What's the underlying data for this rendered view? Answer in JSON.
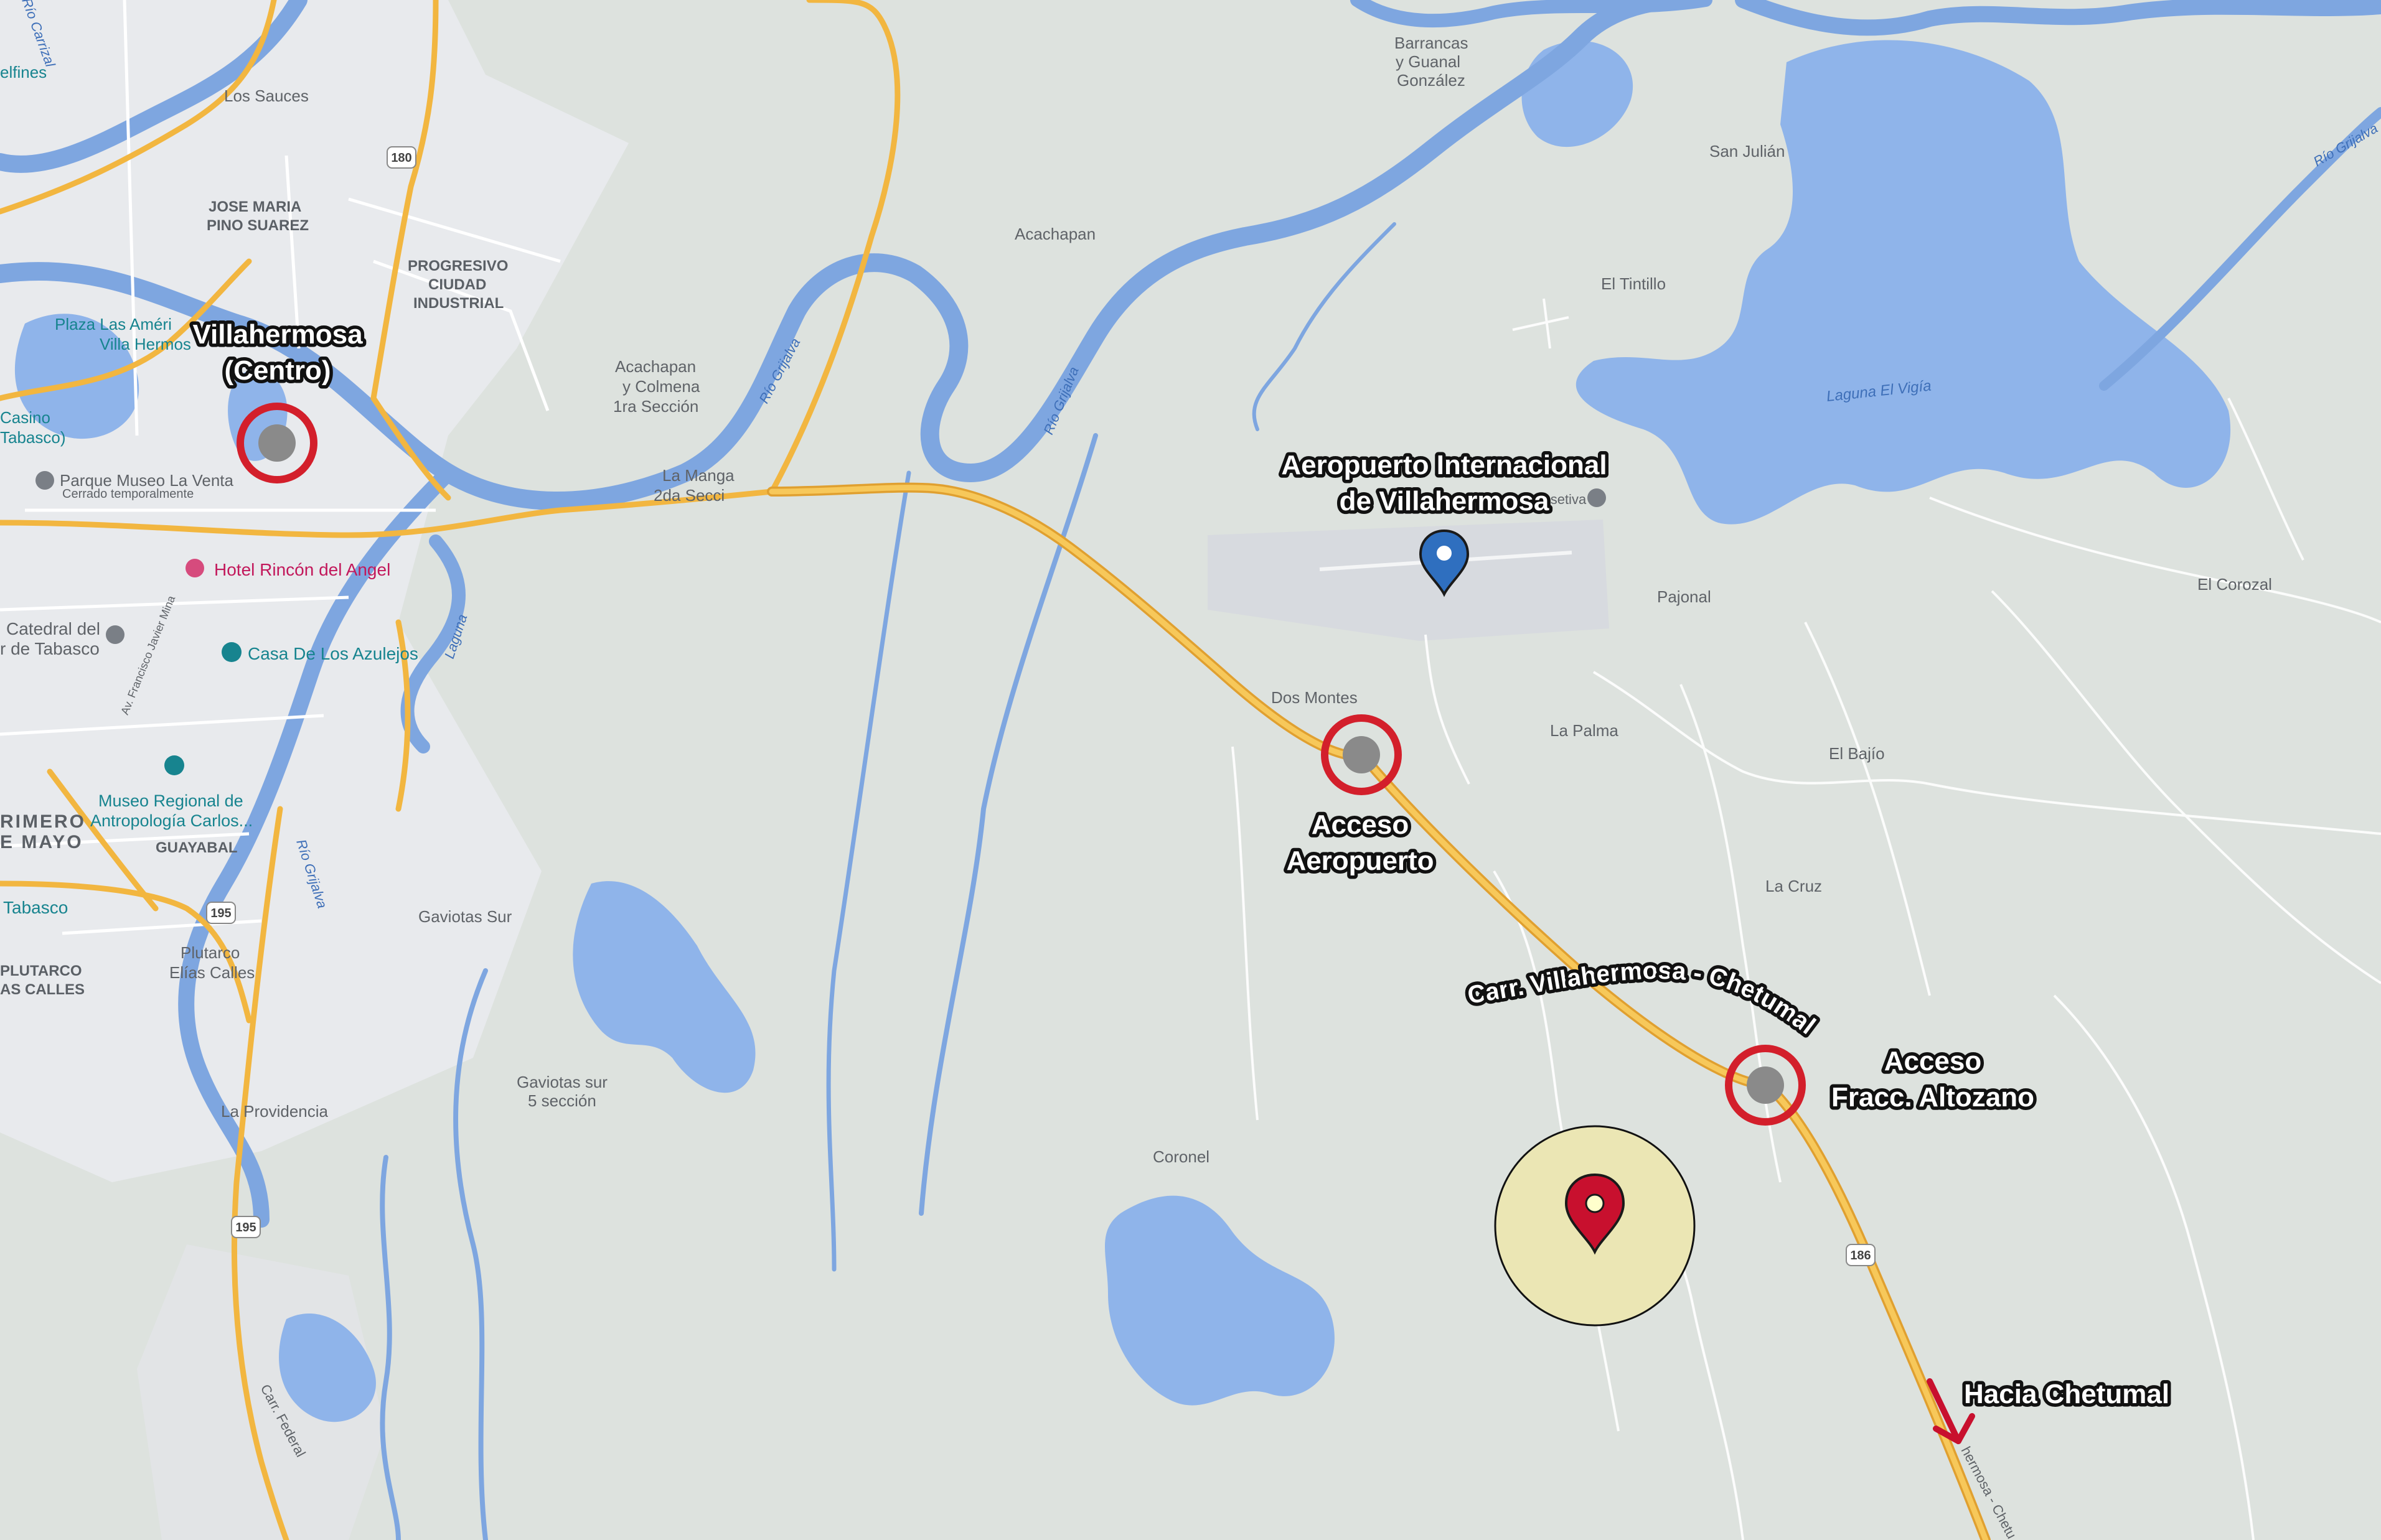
{
  "map": {
    "colors": {
      "land": "#dde2de",
      "urban": "#e8eaed",
      "water": "#8fb4ea",
      "river": "#7ea6e0",
      "highway": "#f2b640",
      "highway_casing": "#e0a030",
      "minor_road": "#ffffff",
      "airport": "#d7dadf",
      "marker_red": "#c8102e",
      "marker_blue": "#2f6fbf",
      "highlight_circle": "#ebe6b4"
    },
    "place_labels": {
      "los_sauces": "Los Sauces",
      "jose_maria_1": "JOSE MARIA",
      "jose_maria_2": "PINO SUAREZ",
      "progresivo_1": "PROGRESIVO",
      "progresivo_2": "CIUDAD",
      "progresivo_3": "INDUSTRIAL",
      "plaza_1": "Plaza Las Améri",
      "plaza_2": "Villa Hermos",
      "casino_1": "Casino",
      "casino_2": "Tabasco)",
      "parque_museo": "Parque Museo La Venta",
      "cerrado": "Cerrado temporalmente",
      "hotel": "Hotel Rincón del Angel",
      "catedral_1": "Catedral del",
      "catedral_2": "r de Tabasco",
      "casa_azulejos": "Casa De Los Azulejos",
      "museo_1": "Museo Regional de",
      "museo_2": "Antropología Carlos...",
      "primero_1": "RIMERO",
      "primero_2": "E MAYO",
      "guayabal": "GUAYABAL",
      "tabasco": "Tabasco",
      "plutarco_1": "PLUTARCO",
      "plutarco_2": "AS CALLES",
      "plutarco_elias_1": "Plutarco",
      "plutarco_elias_2": "Elías Calles",
      "gaviotas_sur": "Gaviotas Sur",
      "gaviotas_5_1": "Gaviotas sur",
      "gaviotas_5_2": "5 sección",
      "la_providencia": "La Providencia",
      "acachapan": "Acachapan",
      "acachapan_colmena_1": "Acachapan",
      "acachapan_colmena_2": "y Colmena",
      "acachapan_colmena_3": "1ra Sección",
      "la_manga_1": "La Manga",
      "la_manga_2": "2da Secci",
      "barrancas_1": "Barrancas",
      "barrancas_2": "y Guanal",
      "barrancas_3": "González",
      "san_julian": "San Julián",
      "el_tintillo": "El Tintillo",
      "pajonal": "Pajonal",
      "el_corozal": "El Corozal",
      "dos_montes": "Dos Montes",
      "la_palma": "La Palma",
      "el_bajio": "El Bajío",
      "la_cruz": "La Cruz",
      "coronel": "Coronel",
      "delfines": "elfines",
      "aero_poi": "Aero Rosetiva"
    },
    "water_labels": {
      "rio_grijalva_1": "Río Grijalva",
      "rio_grijalva_2": "Río Grijalva",
      "rio_grijalva_3": "Río Grijalva",
      "rio_grijalva_ne": "Río Grijalva",
      "laguna_el_vigia": "Laguna El Vigía",
      "laguna": "Laguna",
      "rio_carrizal": "Río Carrizal",
      "carr_federal": "Carr. Federal",
      "av_francisco": "Av. Francisco Javier Mina"
    },
    "road_shields": {
      "r180": "180",
      "r195a": "195",
      "r195b": "195",
      "r186": "186"
    }
  },
  "annotations": {
    "villahermosa_1": "Villahermosa",
    "villahermosa_2": "(Centro)",
    "carretera": "Carr. Villahermosa - Chetumal",
    "aeropuerto_1": "Aeropuerto Internacional",
    "aeropuerto_2": "de Villahermosa",
    "acceso_aero_1": "Acceso",
    "acceso_aero_2": "Aeropuerto",
    "acceso_fracc_1": "Acceso",
    "acceso_fracc_2": "Fracc. Altozano",
    "hacia_chetumal": "Hacia Chetumal",
    "road_label_bottom": "hermosa - Chetu"
  }
}
